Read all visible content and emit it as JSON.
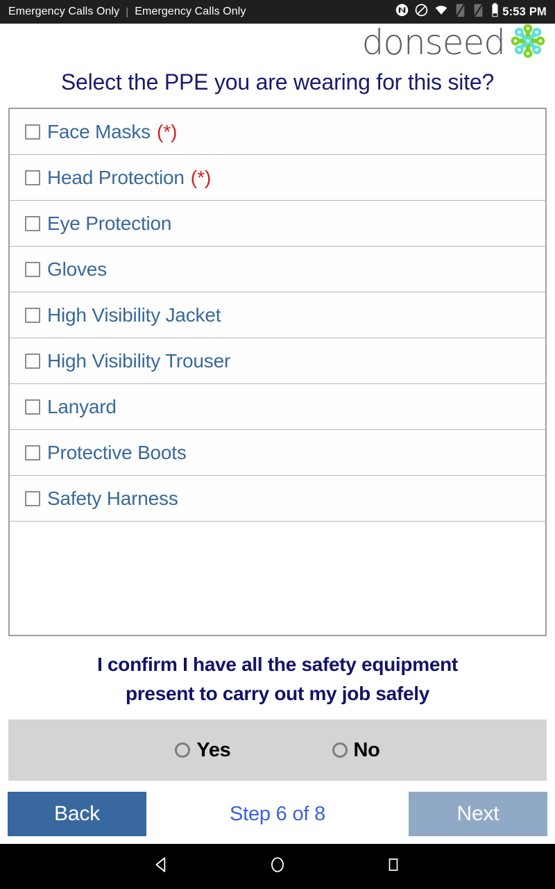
{
  "status_bar": {
    "carrier_left": "Emergency Calls Only",
    "separator": "|",
    "carrier_right": "Emergency Calls Only",
    "clock": "5:53 PM",
    "icons": [
      "nfc-icon",
      "do-not-disturb-icon",
      "wifi-icon",
      "sim-no-signal-icon",
      "sim-no-signal-icon",
      "battery-icon"
    ]
  },
  "brand": {
    "wordmark": "donseed",
    "mark_colors": {
      "green": "#7ed321",
      "cyan": "#5fe0d8"
    }
  },
  "header": {
    "title": "Select the PPE you are wearing for this site?"
  },
  "ppe": {
    "required_marker": "(*)",
    "items": [
      {
        "label": "Face Masks",
        "required": true,
        "checked": false
      },
      {
        "label": "Head Protection",
        "required": true,
        "checked": false
      },
      {
        "label": "Eye Protection",
        "required": false,
        "checked": false
      },
      {
        "label": "Gloves",
        "required": false,
        "checked": false
      },
      {
        "label": "High Visibility Jacket",
        "required": false,
        "checked": false
      },
      {
        "label": "High Visibility Trouser",
        "required": false,
        "checked": false
      },
      {
        "label": "Lanyard",
        "required": false,
        "checked": false
      },
      {
        "label": "Protective Boots",
        "required": false,
        "checked": false
      },
      {
        "label": "Safety Harness",
        "required": false,
        "checked": false
      }
    ]
  },
  "confirmation": {
    "line1": "I confirm I have all the safety equipment",
    "line2": "present to carry out my job safely",
    "options": [
      {
        "label": "Yes",
        "selected": false
      },
      {
        "label": "No",
        "selected": false
      }
    ]
  },
  "footer": {
    "back_label": "Back",
    "next_label": "Next",
    "step_label": "Step 6 of 8",
    "step_current": 6,
    "step_total": 8,
    "back_color": "#38689f",
    "next_color": "#90a9c6",
    "step_color": "#3a62dd"
  },
  "nav_bar": {
    "buttons": [
      "back-triangle-icon",
      "home-circle-icon",
      "recents-square-icon"
    ]
  },
  "colors": {
    "title": "#1a1a6e",
    "item_text": "#38699b",
    "required": "#d32020",
    "confirm_text": "#12126b",
    "band": "#d2d4d6"
  }
}
